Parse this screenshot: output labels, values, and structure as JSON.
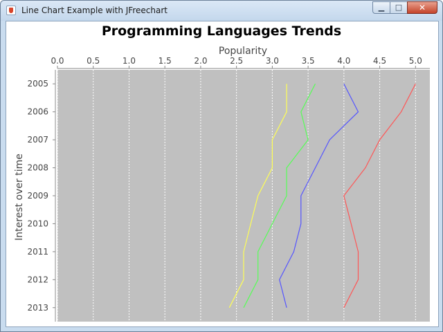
{
  "window": {
    "title": "Line Chart Example with JFreechart",
    "buttons": {
      "minimize": "▁",
      "maximize": "□",
      "close": "✕"
    }
  },
  "chart_data": {
    "type": "line",
    "orientation": "horizontal",
    "title": "Programming Languages Trends",
    "xlabel": "Popularity",
    "ylabel": "Interest over time",
    "xlim": [
      0,
      5.2
    ],
    "x_ticks": [
      "0.0",
      "0.5",
      "1.0",
      "1.5",
      "2.0",
      "2.5",
      "3.0",
      "3.5",
      "4.0",
      "4.5",
      "5.0"
    ],
    "categories": [
      "2005",
      "2006",
      "2007",
      "2008",
      "2009",
      "2010",
      "2011",
      "2012",
      "2013"
    ],
    "grid": true,
    "background": "#c0c0c0",
    "series": [
      {
        "color": "#ff5555",
        "values": [
          5.0,
          4.8,
          4.5,
          4.3,
          4.0,
          4.1,
          4.2,
          4.2,
          4.0
        ]
      },
      {
        "color": "#5555ff",
        "values": [
          4.0,
          4.2,
          3.8,
          3.6,
          3.4,
          3.4,
          3.3,
          3.1,
          3.2
        ]
      },
      {
        "color": "#55ff55",
        "values": [
          3.6,
          3.4,
          3.5,
          3.2,
          3.2,
          3.0,
          2.8,
          2.8,
          2.6
        ]
      },
      {
        "color": "#ffff55",
        "values": [
          3.2,
          3.2,
          3.0,
          3.0,
          2.8,
          2.7,
          2.6,
          2.6,
          2.4
        ]
      }
    ]
  }
}
